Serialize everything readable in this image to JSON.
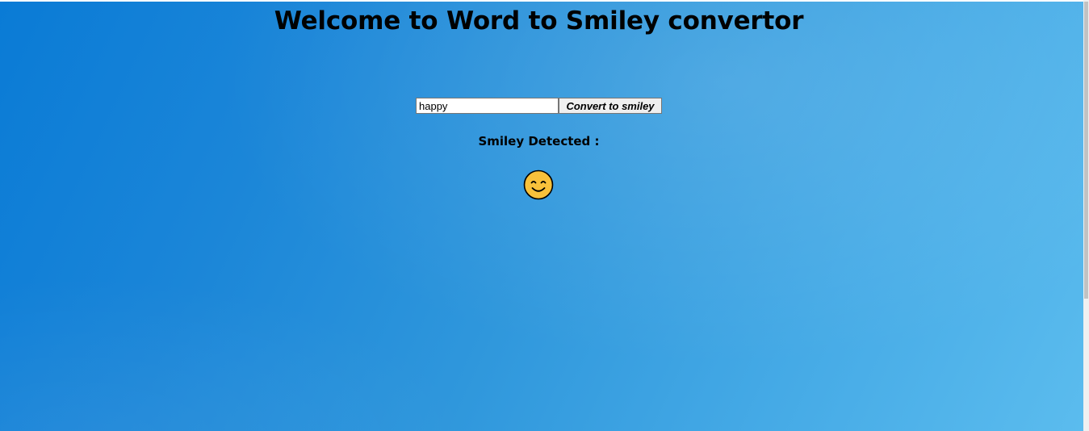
{
  "page": {
    "title": "Welcome to Word to Smiley convertor"
  },
  "form": {
    "input_value": "happy",
    "button_label": "Convert to smiley"
  },
  "result": {
    "label": "Smiley Detected :",
    "smiley_icon": "smiling-face-with-smiling-eyes-icon"
  },
  "colors": {
    "background_start": "#0a7bd6",
    "background_end": "#5bbcee",
    "smiley_fill": "#f8c13b"
  }
}
